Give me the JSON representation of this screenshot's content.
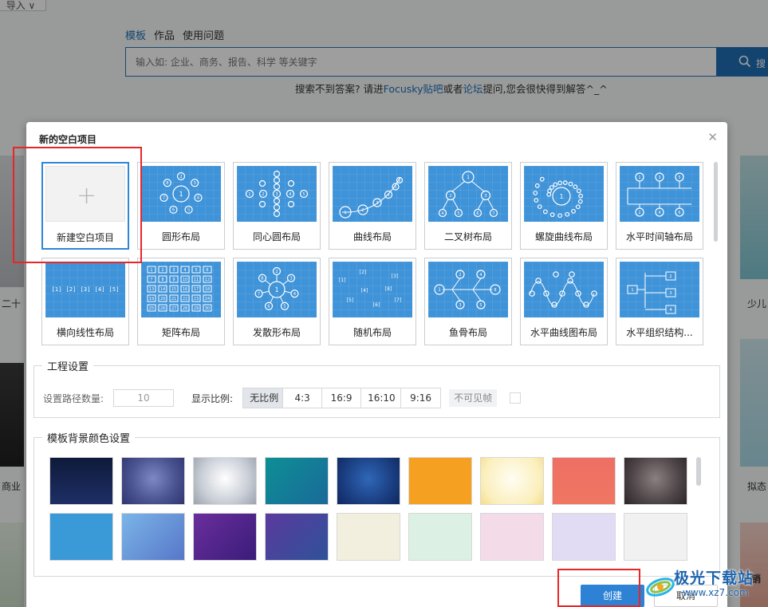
{
  "background": {
    "top_button": "导入 ∨",
    "tabs": [
      {
        "label": "模板",
        "active": true
      },
      {
        "label": "作品",
        "active": false
      },
      {
        "label": "使用问题",
        "active": false
      }
    ],
    "search": {
      "placeholder": "输入如: 企业、商务、报告、科学 等关键字",
      "button_label": "搜"
    },
    "hint": {
      "prefix": "搜索不到答案? 请进",
      "link1": "Focusky贴吧",
      "mid": "或者",
      "link2": "论坛",
      "suffix": "提问,您会很快得到解答^_^"
    },
    "left_labels": [
      "二十",
      "商业"
    ],
    "right_labels": [
      "少儿",
      "拟态",
      "营销"
    ]
  },
  "dialog": {
    "title": "新的空白项目",
    "close_icon": "close-icon",
    "layouts": [
      {
        "label": "新建空白项目",
        "kind": "blank",
        "selected": true
      },
      {
        "label": "圆形布局",
        "kind": "circle"
      },
      {
        "label": "同心圆布局",
        "kind": "concentric"
      },
      {
        "label": "曲线布局",
        "kind": "curve"
      },
      {
        "label": "二叉树布局",
        "kind": "tree"
      },
      {
        "label": "螺旋曲线布局",
        "kind": "spiral"
      },
      {
        "label": "水平时间轴布局",
        "kind": "timeline"
      },
      {
        "label": "横向线性布局",
        "kind": "linear"
      },
      {
        "label": "矩阵布局",
        "kind": "matrix"
      },
      {
        "label": "发散形布局",
        "kind": "radial"
      },
      {
        "label": "随机布局",
        "kind": "random"
      },
      {
        "label": "鱼骨布局",
        "kind": "fishbone"
      },
      {
        "label": "水平曲线图布局",
        "kind": "wave"
      },
      {
        "label": "水平组织结构...",
        "kind": "org"
      }
    ],
    "project_settings": {
      "legend": "工程设置",
      "path_count_label": "设置路径数量:",
      "path_count_value": "10",
      "ratio_label": "显示比例:",
      "ratios": [
        "无比例",
        "4:3",
        "16:9",
        "16:10",
        "9:16"
      ],
      "active_ratio": "无比例",
      "invisible_frame_label": "不可见帧",
      "invisible_frame_checked": false
    },
    "background_settings": {
      "legend": "模板背景颜色设置",
      "swatches": [
        "linear-gradient(180deg,#0e1a3a 0%,#1e2f66 100%)",
        "radial-gradient(circle at 50% 45%,#7d89c4 0%,#4b5591 55%,#2f3570 100%)",
        "radial-gradient(circle at 50% 45%,#ffffff 0%,#c9ced6 60%,#9aa2ad 100%)",
        "linear-gradient(135deg,#0d8f94 0%,#1a6a9a 100%)",
        "radial-gradient(circle at 50% 45%,#2f67b8 0%,#1b3f82 60%,#10275e 100%)",
        "#f5a020",
        "radial-gradient(circle at 50% 45%,#fffdf3 0%,#fbefbd 70%,#f4dc8a 100%)",
        "linear-gradient(180deg,#ee6f64 0%,#f07662 100%)",
        "radial-gradient(circle at 50% 45%,#8b7f80 0%,#4e4548 60%,#2c2527 100%)",
        "#3a9ad8",
        "linear-gradient(135deg,#7bb5e8 0%,#5777c9 100%)",
        "linear-gradient(135deg,#6a2e9c 0%,#3a1c7a 100%)",
        "linear-gradient(135deg,#5b3a9e 0%,#2f5299 100%)",
        "#f3efde",
        "#dcf0e4",
        "#f4dbe8",
        "#e1dcf3",
        "#f1f1f1"
      ]
    },
    "buttons": {
      "create": "创建",
      "cancel": "取消"
    }
  },
  "watermark": {
    "text": "极光下载站",
    "url": "www.xz7.com"
  },
  "colors": {
    "accent": "#2d82d6",
    "annotation": "#e8262a",
    "tile_blue": "#3f93d8"
  }
}
